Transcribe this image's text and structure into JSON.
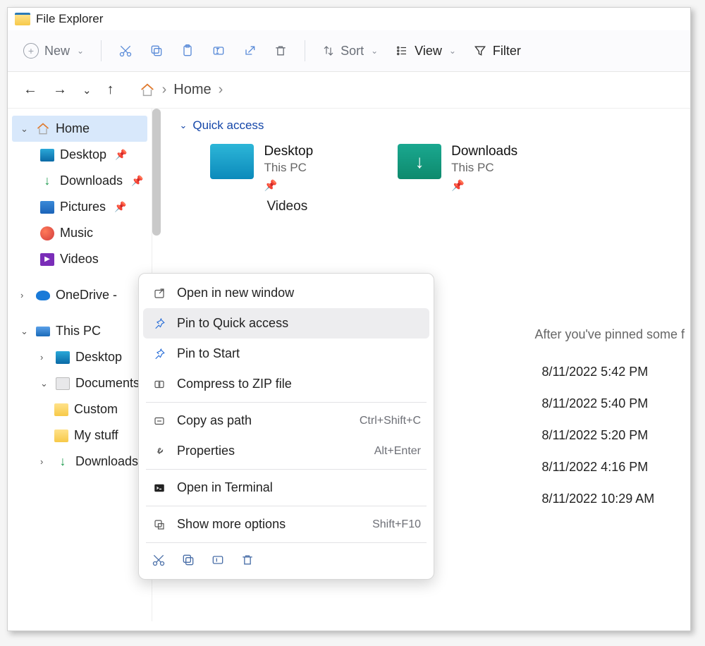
{
  "title": "File Explorer",
  "toolbar": {
    "new_label": "New",
    "sort_label": "Sort",
    "view_label": "View",
    "filter_label": "Filter"
  },
  "breadcrumb": {
    "root": "Home"
  },
  "sidebar": {
    "home": "Home",
    "desktop": "Desktop",
    "downloads": "Downloads",
    "pictures": "Pictures",
    "music": "Music",
    "videos": "Videos",
    "onedrive": "OneDrive -",
    "thispc": "This PC",
    "thispc_desktop": "Desktop",
    "thispc_documents": "Documents",
    "custom": "Custom",
    "mystuff": "My stuff",
    "downloads2": "Downloads"
  },
  "section": {
    "quick_access": "Quick access"
  },
  "tiles": {
    "desktop": {
      "title": "Desktop",
      "sub": "This PC"
    },
    "downloads": {
      "title": "Downloads",
      "sub": "This PC"
    },
    "videos_partial": "Videos"
  },
  "hint": "After you've pinned some f",
  "dates": {
    "r1": "8/11/2022 5:42 PM",
    "r2": "8/11/2022 5:40 PM",
    "r3": "8/11/2022 5:20 PM",
    "r4": "8/11/2022 4:16 PM",
    "r5": "8/11/2022 10:29 AM"
  },
  "context_menu": {
    "open_new_window": "Open in new window",
    "pin_quick": "Pin to Quick access",
    "pin_start": "Pin to Start",
    "compress": "Compress to ZIP file",
    "copy_path": "Copy as path",
    "copy_path_short": "Ctrl+Shift+C",
    "properties": "Properties",
    "properties_short": "Alt+Enter",
    "terminal": "Open in Terminal",
    "more": "Show more options",
    "more_short": "Shift+F10"
  }
}
